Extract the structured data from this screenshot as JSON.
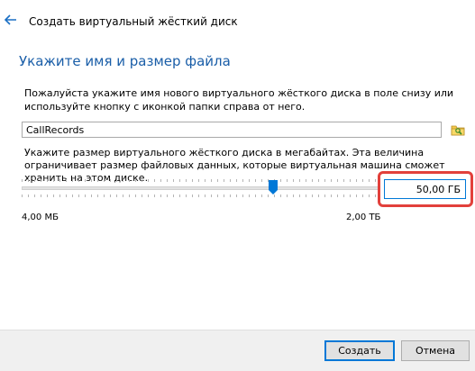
{
  "header": {
    "back_icon": "arrow-left-icon",
    "title": "Создать виртуальный жёсткий диск"
  },
  "wizard": {
    "heading": "Укажите имя и размер файла",
    "name_description": "Пожалуйста укажите имя нового виртуального жёсткого диска в поле снизу или используйте кнопку с иконкой папки справа от него.",
    "file_name": "CallRecords",
    "folder_icon": "folder-browse-icon",
    "size_description": "Укажите размер виртуального жёсткого диска в мегабайтах. Эта величина ограничивает размер файловых данных, которые виртуальная машина сможет хранить на этом диске.",
    "slider": {
      "position_fraction": 0.705,
      "min_label": "4,00 МБ",
      "max_label": "2,00 ТБ"
    },
    "size_value": "50,00 ГБ"
  },
  "footer": {
    "create_label": "Создать",
    "cancel_label": "Отмена"
  },
  "colors": {
    "accent": "#0078d7",
    "heading": "#1a5ea8",
    "highlight": "#e2403b"
  }
}
